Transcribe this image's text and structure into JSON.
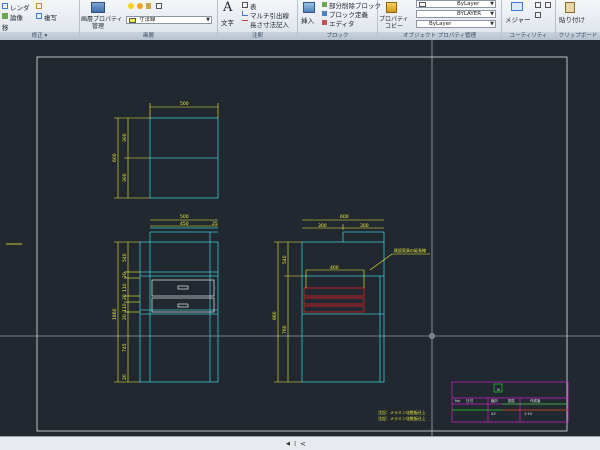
{
  "ribbon": {
    "home_group": {
      "items": [
        "レンダ",
        "論像",
        "複写",
        "移"
      ],
      "title": "修正 ▾"
    },
    "layers_group": {
      "button_label": "画層プロパティ\n管理",
      "button_label_line1": "画層プロパティ",
      "button_label_line2": "管理",
      "current_layer": "寸法線",
      "title": "画層"
    },
    "annotation_group": {
      "text_button": "文字",
      "table_label": "表",
      "multileader_label": "マルチ引出線",
      "linear_dim_label": "長さ寸法記入",
      "title": "注釈"
    },
    "block_group": {
      "insert_button": "挿入",
      "items": [
        "部分削除ブロック",
        "ブロック定義",
        "エディタ"
      ],
      "title": "ブロック"
    },
    "properties_group": {
      "match_button_line1": "プロパティ",
      "match_button_line2": "コピー",
      "color_value": "ByLayer",
      "lineweight_value": "BYLAYER",
      "linetype_value": "ByLayer",
      "title": "オブジェクト プロパティ管理"
    },
    "utilities_group": {
      "measure_button": "メジャー",
      "title": "ユーティリティ"
    },
    "clipboard_group": {
      "paste_button": "貼り付け",
      "title": "クリップボード"
    }
  },
  "drawing": {
    "top_view": {
      "width_dim": "500",
      "height_dim": "600",
      "dim_upper": "300",
      "dim_lower": "300"
    },
    "front_view": {
      "top_dims": [
        "500",
        "450",
        "25"
      ],
      "height_total": "1860",
      "height_dims": [
        "540",
        "20",
        "110",
        "20",
        "110",
        "20",
        "745",
        "20"
      ]
    },
    "side_view": {
      "top_dims": [
        "600",
        "300",
        "300"
      ],
      "inner_dim": "400",
      "height_dims": [
        "540",
        "760"
      ],
      "height_total": "860",
      "note": "既設家具の延長線"
    },
    "notes": [
      "注記：メラミン化粧板仕上",
      "注記：メラミン化粧板仕上"
    ],
    "title_block": {
      "row1": [
        "No.",
        "日付",
        "縮尺",
        "図名",
        "作成者"
      ],
      "row2": [
        "N",
        "A3",
        "1:10"
      ]
    }
  },
  "tabs": {
    "nav_prev": "◀",
    "nav_sep": "⁞",
    "nav_next": "<"
  },
  "colors": {
    "background": "#212830",
    "cyan": "#39c6d0",
    "yellow": "#f0f038",
    "red": "#e02020",
    "magenta": "#d020d0",
    "green": "#20d020",
    "white": "#e8e8e8"
  }
}
